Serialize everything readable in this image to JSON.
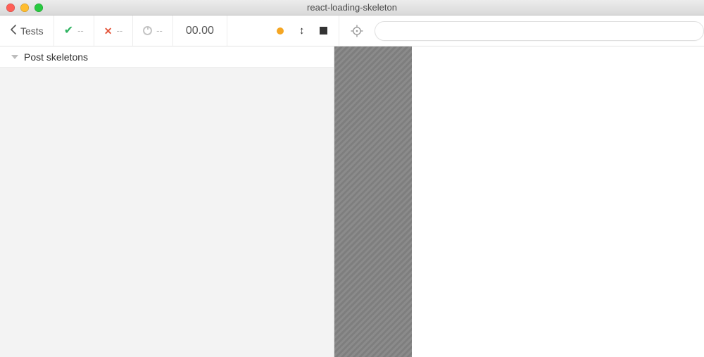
{
  "window": {
    "title": "react-loading-skeleton"
  },
  "traffic": {
    "close": "#ff5f57",
    "min": "#ffbd2e",
    "max": "#28c940"
  },
  "toolbar": {
    "back_label": "Tests",
    "passed_count": "--",
    "failed_count": "--",
    "pending_count": "--",
    "timer": "00.00"
  },
  "sidebar": {
    "items": [
      {
        "label": "Post skeletons"
      }
    ]
  },
  "url": {
    "value": ""
  }
}
